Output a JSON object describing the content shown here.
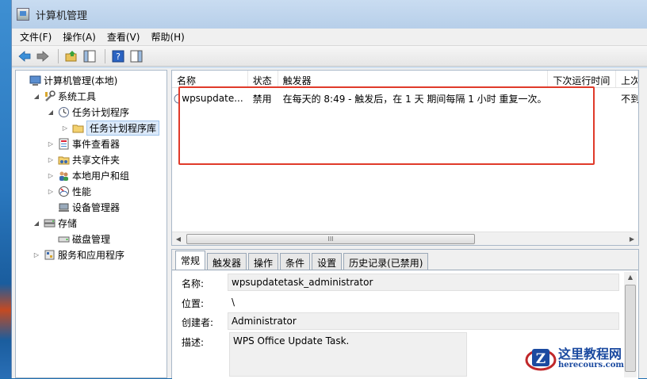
{
  "window": {
    "title": "计算机管理"
  },
  "menu": [
    "文件(F)",
    "操作(A)",
    "查看(V)",
    "帮助(H)"
  ],
  "tree": [
    {
      "label": "计算机管理(本地)",
      "level": 0,
      "expander": "",
      "icon": "computer-management-icon"
    },
    {
      "label": "系统工具",
      "level": 1,
      "expander": "◢",
      "icon": "tools-icon"
    },
    {
      "label": "任务计划程序",
      "level": 2,
      "expander": "◢",
      "icon": "clock-icon"
    },
    {
      "label": "任务计划程序库",
      "level": 3,
      "expander": "▷",
      "icon": "folder-icon",
      "selected": true
    },
    {
      "label": "事件查看器",
      "level": 2,
      "expander": "▷",
      "icon": "event-viewer-icon"
    },
    {
      "label": "共享文件夹",
      "level": 2,
      "expander": "▷",
      "icon": "shared-folder-icon"
    },
    {
      "label": "本地用户和组",
      "level": 2,
      "expander": "▷",
      "icon": "users-icon"
    },
    {
      "label": "性能",
      "level": 2,
      "expander": "▷",
      "icon": "performance-icon"
    },
    {
      "label": "设备管理器",
      "level": 2,
      "expander": "",
      "icon": "device-manager-icon"
    },
    {
      "label": "存储",
      "level": 1,
      "expander": "◢",
      "icon": "storage-icon"
    },
    {
      "label": "磁盘管理",
      "level": 2,
      "expander": "",
      "icon": "disk-icon"
    },
    {
      "label": "服务和应用程序",
      "level": 1,
      "expander": "▷",
      "icon": "services-icon"
    }
  ],
  "task_list": {
    "columns": [
      "名称",
      "状态",
      "触发器",
      "下次运行时间",
      "上次"
    ],
    "rows": [
      {
        "name": "wpsupdate...",
        "status": "禁用",
        "trigger": "在每天的 8:49 - 触发后，在 1 天 期间每隔 1 小时 重复一次。",
        "next_run": "",
        "last_run": "不到"
      }
    ],
    "scroll_glyph": "III"
  },
  "detail": {
    "tabs": [
      "常规",
      "触发器",
      "操作",
      "条件",
      "设置",
      "历史记录(已禁用)"
    ],
    "active_tab": "常规",
    "fields": {
      "name_label": "名称:",
      "name_value": "wpsupdatetask_administrator",
      "location_label": "位置:",
      "location_value": "\\",
      "author_label": "创建者:",
      "author_value": "Administrator",
      "description_label": "描述:",
      "description_value": "WPS Office Update Task."
    }
  },
  "watermark": {
    "title": "这里教程网",
    "url": "herecours.com"
  },
  "colors": {
    "highlight_box": "#e03a2a",
    "selection": "#dbe9fa",
    "brand": "#1b4aa0"
  }
}
